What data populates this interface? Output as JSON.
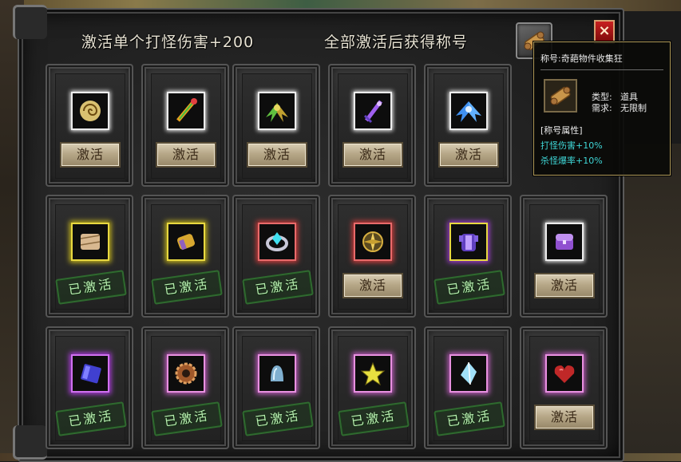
{
  "header": {
    "left_title": "激活单个打怪伤害+200",
    "right_title": "全部激活后获得称号",
    "close_label": "×"
  },
  "labels": {
    "activate": "激活",
    "activated": "已激活"
  },
  "cards": [
    {
      "row": 0,
      "col": 0,
      "icon": "spiral-scroll-icon",
      "glow": "white",
      "state": "activate"
    },
    {
      "row": 0,
      "col": 1,
      "icon": "rainbow-staff-icon",
      "glow": "white",
      "state": "activate"
    },
    {
      "row": 0,
      "col": 2,
      "icon": "green-wings-icon",
      "glow": "white",
      "state": "activate"
    },
    {
      "row": 0,
      "col": 3,
      "icon": "purple-sword-icon",
      "glow": "white",
      "state": "activate"
    },
    {
      "row": 0,
      "col": 4,
      "icon": "blue-wings-icon",
      "glow": "white",
      "state": "activate"
    },
    {
      "row": 1,
      "col": 0,
      "icon": "cloth-scroll-icon",
      "glow": "yellow",
      "state": "activated"
    },
    {
      "row": 1,
      "col": 1,
      "icon": "gold-gauntlet-icon",
      "glow": "yellow",
      "state": "activated"
    },
    {
      "row": 1,
      "col": 2,
      "icon": "cyan-crystal-ring-icon",
      "glow": "red",
      "state": "activated"
    },
    {
      "row": 1,
      "col": 3,
      "icon": "gold-compass-icon",
      "glow": "red",
      "state": "activate"
    },
    {
      "row": 1,
      "col": 4,
      "icon": "purple-armor-icon",
      "glow": "dual",
      "state": "activated"
    },
    {
      "row": 1,
      "col": 5,
      "icon": "purple-chest-icon",
      "glow": "white",
      "state": "activate"
    },
    {
      "row": 2,
      "col": 0,
      "icon": "blue-tome-icon",
      "glow": "purple",
      "state": "activated"
    },
    {
      "row": 2,
      "col": 1,
      "icon": "bronze-gear-icon",
      "glow": "pink",
      "state": "activated"
    },
    {
      "row": 2,
      "col": 2,
      "icon": "crystal-bell-icon",
      "glow": "pink",
      "state": "activated"
    },
    {
      "row": 2,
      "col": 3,
      "icon": "yellow-star-icon",
      "glow": "pink",
      "state": "activated"
    },
    {
      "row": 2,
      "col": 4,
      "icon": "ice-crystal-icon",
      "glow": "pink",
      "state": "activated"
    },
    {
      "row": 2,
      "col": 5,
      "icon": "red-heart-icon",
      "glow": "pink",
      "state": "activate"
    }
  ],
  "tooltip": {
    "title": "称号:奇葩物件收集狂",
    "type_label": "类型:",
    "type_value": "道具",
    "req_label": "需求:",
    "req_value": "无限制",
    "attr_header": "[称号属性]",
    "attr_1": "打怪伤害+10%",
    "attr_2": "杀怪爆率+10%",
    "attr_color": "#3fd7d7"
  }
}
